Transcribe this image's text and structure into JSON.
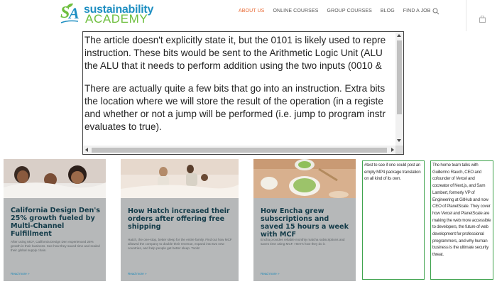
{
  "header": {
    "logo": {
      "word1": "sustainability",
      "word2": "ACADEMY",
      "green": "#6fbf3f",
      "blue": "#1f8fc2"
    },
    "nav": [
      {
        "label": "ABOUT US",
        "active": true
      },
      {
        "label": "ONLINE COURSES",
        "active": false
      },
      {
        "label": "GROUP COURSES",
        "active": false
      },
      {
        "label": "BLOG",
        "active": false
      },
      {
        "label": "FIND A JOB",
        "active": false
      }
    ],
    "accent": "#e8662f",
    "icons": [
      "search-icon",
      "shopping-bag-icon"
    ]
  },
  "article": {
    "paragraphs": [
      [
        "The article doesn't explicitly state it, but the 0101 is likely used to repre",
        "instruction. These bits would be sent to the Arithmetic Logic Unit (ALU",
        "the ALU that it needs to perform addition using the two inputs (0010 &"
      ],
      [
        "There are actually quite a few bits that go into an instruction. Extra bits",
        "the location where we will store the result of the operation (in a registe",
        "and whether or not a jump will be performed (i.e. jump to program instr",
        "evaluates to true)."
      ]
    ]
  },
  "cards": [
    {
      "title": "California Design Den's 25% growth fueled by Multi-Channel Fulfillment",
      "description": "After using MCF, California Design Den experienced 25% growth in their business. See how they saved time and scaled their global supply chain.",
      "link": "Read more »"
    },
    {
      "title": "How Hatch increased their orders after offering free shipping",
      "description": "Hatch, the one-stop, better sleep for the entire family. Find out how MCF allowed the company to double their revenue, expand into two new countries, and help people get better sleep. Tools!",
      "link": "Read more »"
    },
    {
      "title": "How Encha grew subscriptions and saved 15 hours a week with MCF",
      "description": "Encha provides reliable monthly matcha subscriptions and saves time using MCF. Here's how they do it.",
      "link": "Read more »"
    }
  ],
  "textboxes": [
    {
      "text": "#test to see if one could post an empty MP4 package translation on all kind of its own."
    },
    {
      "text": "The home team talks with Guillermo Rauch, CEO and cofounder of Vercel and cocreator of Next.js, and Sam Lambert, formerly VP of Engineering at GitHub and now CEO of PlanetScale. They cover how Vercel and PlanetScale are making the web more accessible to developers, the future of web development for professional programmers, and why human business is the ultimate security threat."
    }
  ],
  "colors": {
    "card_bg": "#b6b8b9",
    "title": "#123a48",
    "link": "#1e88b8",
    "box_border": "#3fa34d"
  }
}
